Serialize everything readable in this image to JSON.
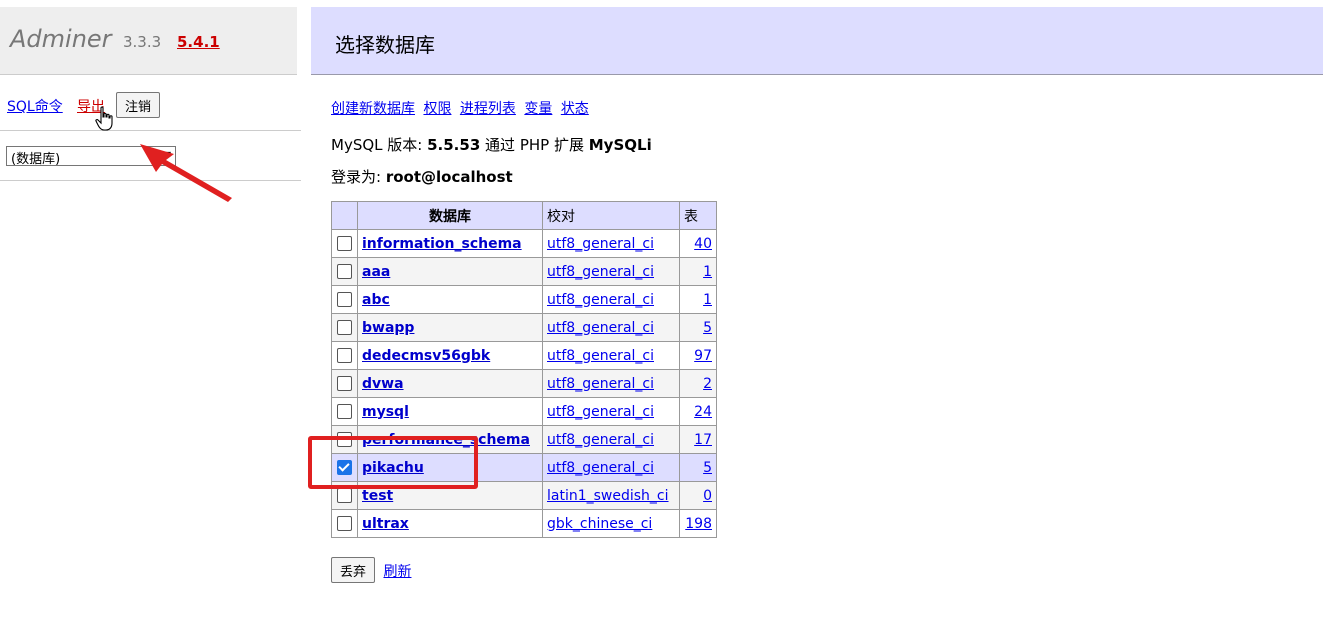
{
  "sidebar": {
    "app_name": "Adminer",
    "version": "3.3.3",
    "new_version": "5.4.1",
    "sql_link": "SQL命令",
    "export_link": "导出",
    "logout_button": "注销",
    "db_select_value": "(数据库)"
  },
  "header": {
    "title": "选择数据库"
  },
  "links": [
    "创建新数据库",
    "权限",
    "进程列表",
    "变量",
    "状态"
  ],
  "info": {
    "mysql_label": "MySQL 版本:",
    "mysql_version": "5.5.53",
    "via_label": "通过 PHP 扩展",
    "extension": "MySQLi",
    "login_label": "登录为:",
    "login_user": "root@localhost"
  },
  "table": {
    "headers": [
      "数据库",
      "校对",
      "表"
    ],
    "rows": [
      {
        "name": "information_schema",
        "collation": "utf8_general_ci",
        "tables": "40",
        "checked": false
      },
      {
        "name": "aaa",
        "collation": "utf8_general_ci",
        "tables": "1",
        "checked": false
      },
      {
        "name": "abc",
        "collation": "utf8_general_ci",
        "tables": "1",
        "checked": false
      },
      {
        "name": "bwapp",
        "collation": "utf8_general_ci",
        "tables": "5",
        "checked": false
      },
      {
        "name": "dedecmsv56gbk",
        "collation": "utf8_general_ci",
        "tables": "97",
        "checked": false
      },
      {
        "name": "dvwa",
        "collation": "utf8_general_ci",
        "tables": "2",
        "checked": false
      },
      {
        "name": "mysql",
        "collation": "utf8_general_ci",
        "tables": "24",
        "checked": false
      },
      {
        "name": "performance_schema",
        "collation": "utf8_general_ci",
        "tables": "17",
        "checked": false
      },
      {
        "name": "pikachu",
        "collation": "utf8_general_ci",
        "tables": "5",
        "checked": true
      },
      {
        "name": "test",
        "collation": "latin1_swedish_ci",
        "tables": "0",
        "checked": false
      },
      {
        "name": "ultrax",
        "collation": "gbk_chinese_ci",
        "tables": "198",
        "checked": false
      }
    ]
  },
  "actions": {
    "drop_button": "丢弃",
    "refresh_link": "刷新"
  },
  "colors": {
    "header_bg": "#ddddff",
    "annotation": "#e02020",
    "checkbox_on": "#1a73e8"
  }
}
